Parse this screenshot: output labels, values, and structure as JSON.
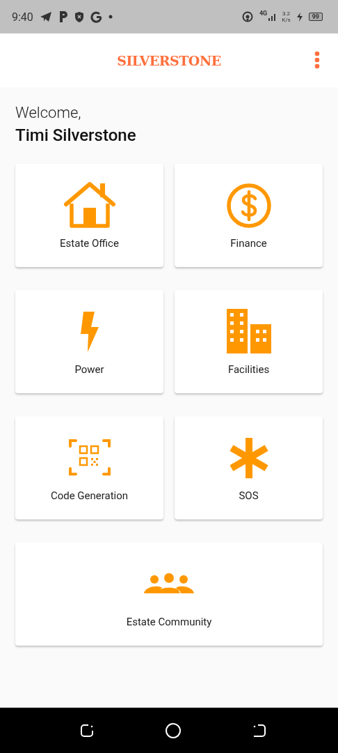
{
  "status_bar": {
    "time": "9:40",
    "network": "4G",
    "speed_value": "3.2",
    "speed_unit": "K/s",
    "battery": "99"
  },
  "app_bar": {
    "title": "SILVERSTONE"
  },
  "greeting": {
    "welcome": "Welcome,",
    "name": "Timi Silverstone"
  },
  "tiles": [
    {
      "kind": "house",
      "label": "Estate Office"
    },
    {
      "kind": "dollar",
      "label": "Finance"
    },
    {
      "kind": "bolt",
      "label": "Power"
    },
    {
      "kind": "building",
      "label": "Facilities"
    },
    {
      "kind": "qr",
      "label": "Code Generation"
    },
    {
      "kind": "asterisk",
      "label": "SOS"
    },
    {
      "kind": "people",
      "label": "Estate Community"
    }
  ]
}
